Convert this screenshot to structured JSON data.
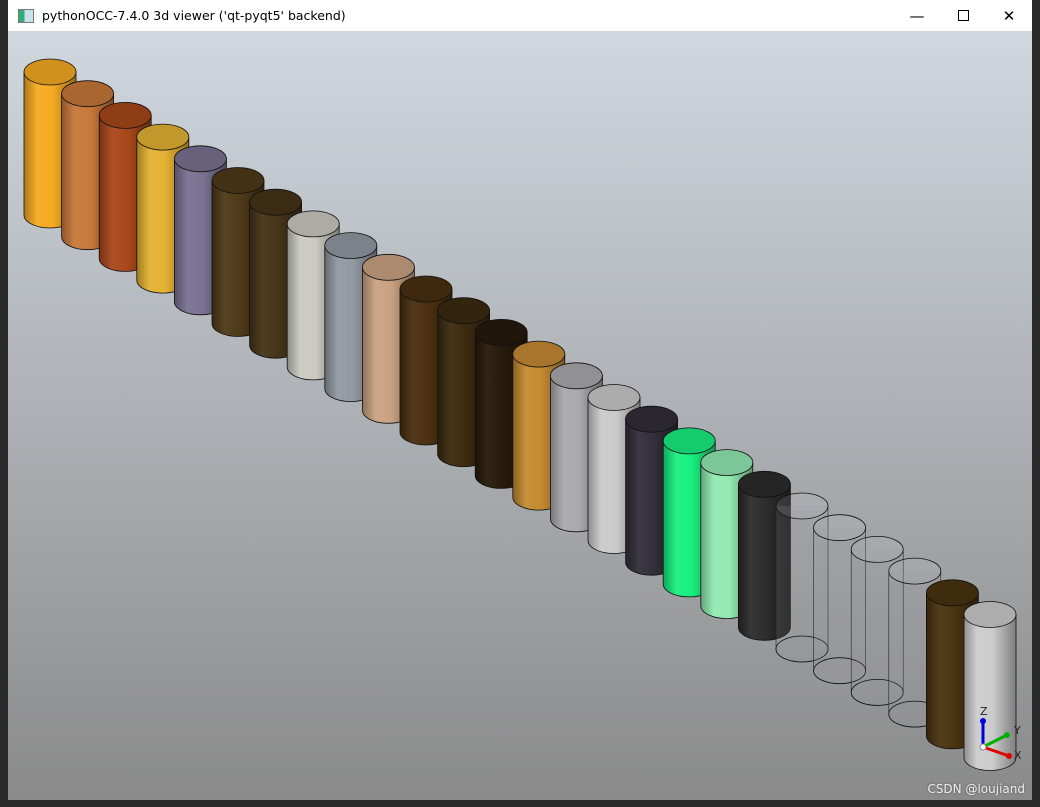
{
  "window": {
    "title": "pythonOCC-7.4.0 3d viewer ('qt-pyqt5' backend)",
    "minimize_icon": "minimize-icon",
    "maximize_icon": "maximize-icon",
    "close_icon": "close-icon"
  },
  "viewer": {
    "cylinder_colors": [
      "#f5aa22",
      "#c8783a",
      "#a8481a",
      "#e4b232",
      "#7a7292",
      "#4e3a18",
      "#463418",
      "#cacac2",
      "#9299a2",
      "#caa282",
      "#4a3010",
      "#3c2a10",
      "#261a0a",
      "#c48a32",
      "#aaaaae",
      "#cacaca",
      "#322e3a",
      "#18f080",
      "#92eab2",
      "#2c2c2c",
      "transparent",
      "transparent",
      "transparent",
      "transparent",
      "#4a3410",
      "#cccccc"
    ],
    "triad": {
      "x_label": "X",
      "y_label": "Y",
      "z_label": "Z",
      "x_color": "#e00000",
      "y_color": "#00b000",
      "z_color": "#0000e0"
    },
    "watermark": "CSDN @loujiand"
  }
}
